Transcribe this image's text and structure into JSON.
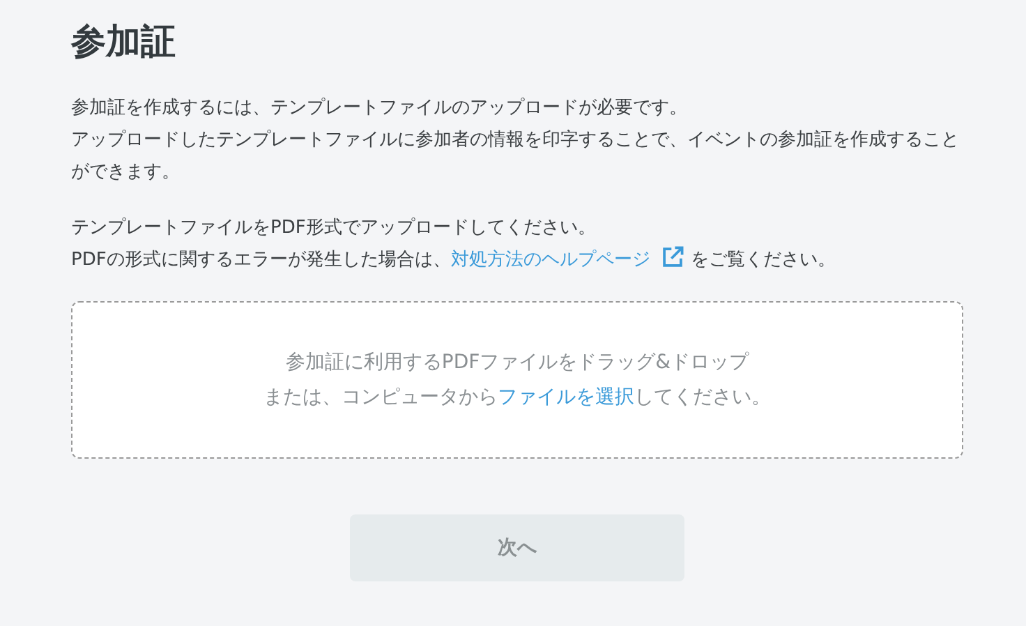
{
  "title": "参加証",
  "intro": [
    "参加証を作成するには、テンプレートファイルのアップロードが必要です。",
    "アップロードしたテンプレートファイルに参加者の情報を印字することで、イベントの参加証を作成することができます。"
  ],
  "notes": [
    {
      "text": "テンプレートファイルをPDF形式でアップロードしてください。"
    },
    {
      "text": "PDFの形式に関するエラーが発生した場合は、",
      "link": "対処方法のヘルプページ",
      "after": "をご覧ください。"
    }
  ],
  "dropzone": {
    "line": "参加証に利用するPDFファイルをドラッグ&ドロップ",
    "prefix": "または、コンピュータから",
    "link": "ファイルを選択",
    "suffix": "してください。"
  },
  "next_button": {
    "label": "次へ",
    "disabled": true
  }
}
